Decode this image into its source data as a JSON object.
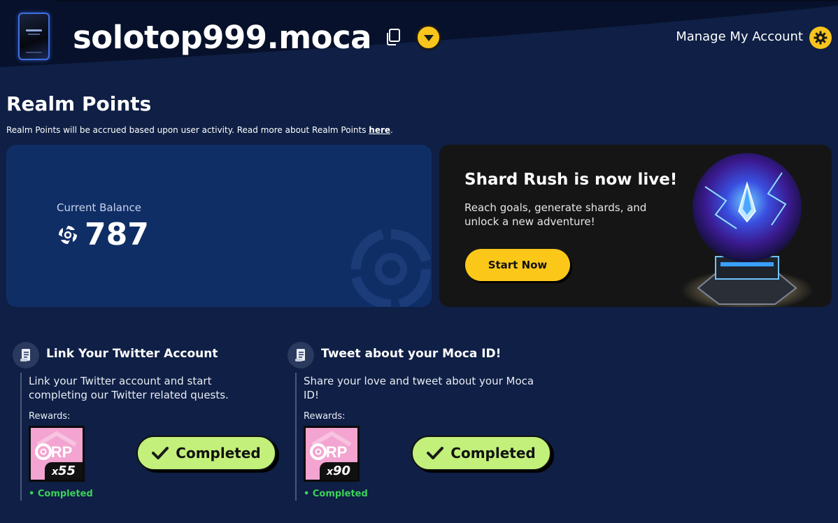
{
  "header": {
    "username": "solotop999.moca",
    "manage_account_label": "Manage My Account"
  },
  "realm": {
    "title": "Realm Points",
    "description": "Realm Points will be accrued based upon user activity. Read more about Realm Points ",
    "link_label": "here",
    "description_end": "."
  },
  "balance": {
    "label": "Current Balance",
    "value": "787"
  },
  "promo": {
    "title": "Shard Rush is now live!",
    "text": "Reach goals, generate shards, and unlock a new adventure!",
    "button_label": "Start Now"
  },
  "quests": [
    {
      "title": "Link Your Twitter Account",
      "description": "Link your Twitter account and start completing our Twitter related quests.",
      "rewards_label": "Rewards:",
      "reward_multiplier": "x",
      "reward_amount": "55",
      "button_label": "Completed",
      "status": "Completed"
    },
    {
      "title": "Tweet about your Moca ID!",
      "description": "Share your love and tweet about your Moca ID!",
      "rewards_label": "Rewards:",
      "reward_multiplier": "x",
      "reward_amount": "90",
      "button_label": "Completed",
      "status": "Completed"
    }
  ],
  "colors": {
    "background": "#0f1f45",
    "card": "#102e66",
    "accent_yellow": "#f8c51c",
    "completed_green": "#c2f07a",
    "status_green": "#3cd15a",
    "reward_pink": "#f3a4d0"
  }
}
